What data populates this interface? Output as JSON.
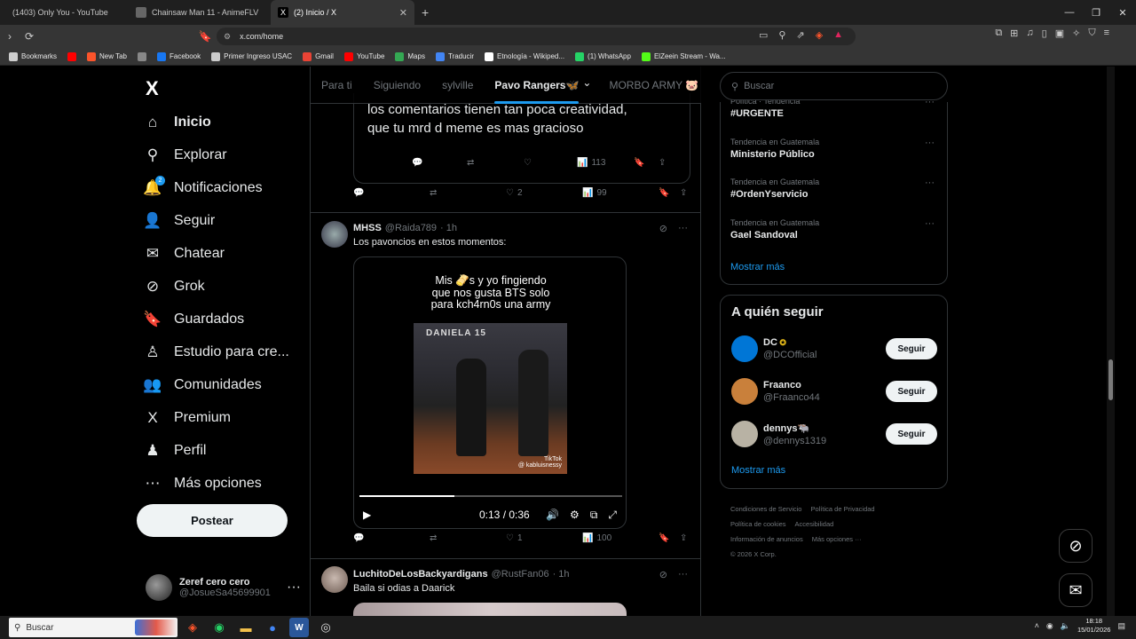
{
  "browser": {
    "tabs": [
      {
        "title": "(1403) Only You - YouTube",
        "active": false,
        "icon_color": "#ff0000"
      },
      {
        "title": "Chainsaw Man 11 - AnimeFLV",
        "active": false,
        "icon_color": "#555555"
      },
      {
        "title": "(2) Inicio / X",
        "active": true,
        "icon_color": "#000000"
      }
    ],
    "new_tab": "+",
    "url": "x.com/home",
    "bookmarks": [
      {
        "label": "Bookmarks",
        "icon": "folder-icon",
        "color": "#cfcfcf"
      },
      {
        "label": "",
        "icon": "youtube-icon",
        "color": "#ff0000"
      },
      {
        "label": "New Tab",
        "icon": "brave-icon",
        "color": "#fb542b"
      },
      {
        "label": "",
        "icon": "image-icon",
        "color": "#888888"
      },
      {
        "label": "Facebook",
        "icon": "facebook-icon",
        "color": "#1877f2"
      },
      {
        "label": "Primer Ingreso USAC",
        "icon": "globe-icon",
        "color": "#cccccc"
      },
      {
        "label": "Gmail",
        "icon": "gmail-icon",
        "color": "#ea4335"
      },
      {
        "label": "YouTube",
        "icon": "youtube-icon",
        "color": "#ff0000"
      },
      {
        "label": "Maps",
        "icon": "maps-icon",
        "color": "#34a853"
      },
      {
        "label": "Traducir",
        "icon": "translate-icon",
        "color": "#4285f4"
      },
      {
        "label": "Etnología - Wikiped...",
        "icon": "wikipedia-icon",
        "color": "#ffffff"
      },
      {
        "label": "(1) WhatsApp",
        "icon": "whatsapp-icon",
        "color": "#25d366"
      },
      {
        "label": "ElZeein Stream - Wa...",
        "icon": "kick-icon",
        "color": "#53fc18"
      }
    ]
  },
  "nav": {
    "logo": "X",
    "items": [
      {
        "label": "Inicio",
        "icon": "home-icon",
        "glyph": "⌂",
        "bold": true
      },
      {
        "label": "Explorar",
        "icon": "search-icon",
        "glyph": "⚲"
      },
      {
        "label": "Notificaciones",
        "icon": "bell-icon",
        "glyph": "🔔",
        "badge": "2"
      },
      {
        "label": "Seguir",
        "icon": "follow-icon",
        "glyph": "👤"
      },
      {
        "label": "Chatear",
        "icon": "mail-icon",
        "glyph": "✉"
      },
      {
        "label": "Grok",
        "icon": "grok-icon",
        "glyph": "⊘"
      },
      {
        "label": "Guardados",
        "icon": "bookmark-icon",
        "glyph": "🔖"
      },
      {
        "label": "Estudio para cre...",
        "icon": "studio-icon",
        "glyph": "♙"
      },
      {
        "label": "Comunidades",
        "icon": "communities-icon",
        "glyph": "👥"
      },
      {
        "label": "Premium",
        "icon": "x-icon",
        "glyph": "X"
      },
      {
        "label": "Perfil",
        "icon": "profile-icon",
        "glyph": "♟"
      },
      {
        "label": "Más opciones",
        "icon": "more-icon",
        "glyph": "⋯"
      }
    ],
    "post_button": "Postear",
    "account": {
      "name": "Zeref cero cero",
      "handle": "@JosueSa45699901"
    }
  },
  "feed": {
    "tabs": [
      {
        "label": "Para ti",
        "active": false
      },
      {
        "label": "Siguiendo",
        "active": false
      },
      {
        "label": "sylville",
        "active": false
      },
      {
        "label": "Pavo Rangers🦋",
        "active": true
      },
      {
        "label": "MORBO ARMY 🐷",
        "active": false
      }
    ],
    "quoted_text": "los comentarios tienen tan poca creatividad, que tu mrd d meme es mas gracioso",
    "quoted_views": "113",
    "tweet1_actions": {
      "replies": "",
      "retweets": "",
      "likes": "2",
      "views": "99"
    },
    "tweet2": {
      "name": "MHSS",
      "handle": "@Raida789",
      "time": "· 1h",
      "text": "Los pavoncios en estos momentos:",
      "video_caption_line1": "Mis 🫔s y yo fingiendo",
      "video_caption_line2": "que nos gusta BTS solo",
      "video_caption_line3": "para kch4rn0s una army",
      "video_banner": "DANIELA 15",
      "tiktok_label": "TikTok",
      "tiktok_user": "@ kabluisnessy",
      "video_time": "0:13 / 0:36",
      "progress": 0.36,
      "likes": "1",
      "views": "100"
    },
    "tweet3": {
      "name": "LuchitoDeLosBackyardigans",
      "handle": "@RustFan06",
      "time": "· 1h",
      "text": "Baila si odias a Daarick"
    }
  },
  "sidebar": {
    "search_placeholder": "Buscar",
    "trends": [
      {
        "category": "Política · Tendencia",
        "title": "#URGENTE"
      },
      {
        "category": "Tendencia en Guatemala",
        "title": "Ministerio Público"
      },
      {
        "category": "Tendencia en Guatemala",
        "title": "#OrdenYservicio"
      },
      {
        "category": "Tendencia en Guatemala",
        "title": "Gael Sandoval"
      }
    ],
    "show_more": "Mostrar más",
    "who_to_follow_title": "A quién seguir",
    "who_to_follow": [
      {
        "name": "DC",
        "handle": "@DCOfficial",
        "verified": true,
        "color": "#0076d6"
      },
      {
        "name": "Fraanco",
        "handle": "@Fraanco44",
        "verified": false,
        "color": "#c9803b"
      },
      {
        "name": "dennys🐃",
        "handle": "@dennys1319",
        "verified": false,
        "color": "#b8b2a4"
      }
    ],
    "follow_label": "Seguir",
    "footer": [
      "Condiciones de Servicio",
      "Política de Privacidad",
      "Política de cookies",
      "Accesibilidad",
      "Información de anuncios",
      "Más opciones ···",
      "© 2026 X Corp."
    ]
  },
  "taskbar": {
    "search": "Buscar",
    "time": "18:18",
    "date": "15/01/2026"
  }
}
